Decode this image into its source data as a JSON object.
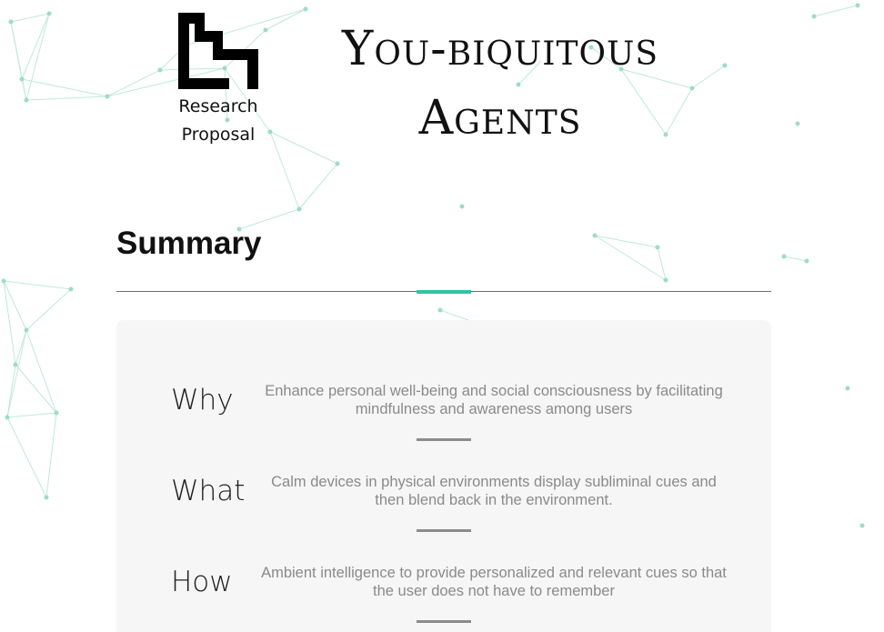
{
  "header": {
    "logo_caption_line1": "Research",
    "logo_caption_line2": "Proposal",
    "title_line1": "You-biquitous",
    "title_line2": "Agents"
  },
  "summary": {
    "heading": "Summary",
    "rows": [
      {
        "label": "Why",
        "text": "Enhance personal well-being and social consciousness by facilitating mindfulness and awareness among users"
      },
      {
        "label": "What",
        "text": "Calm devices in physical environments display subliminal cues and then blend back in the environment."
      },
      {
        "label": "How",
        "text": "Ambient intelligence to provide personalized and relevant cues so that the user does not have to remember"
      }
    ]
  },
  "colors": {
    "accent": "#2ec4a6",
    "network": "#9ddcc8",
    "card_background": "#f6f6f6",
    "body_text": "#8a8a8a"
  },
  "icons": {
    "logo": "stepped-block-logo-icon",
    "background": "network-graph"
  }
}
